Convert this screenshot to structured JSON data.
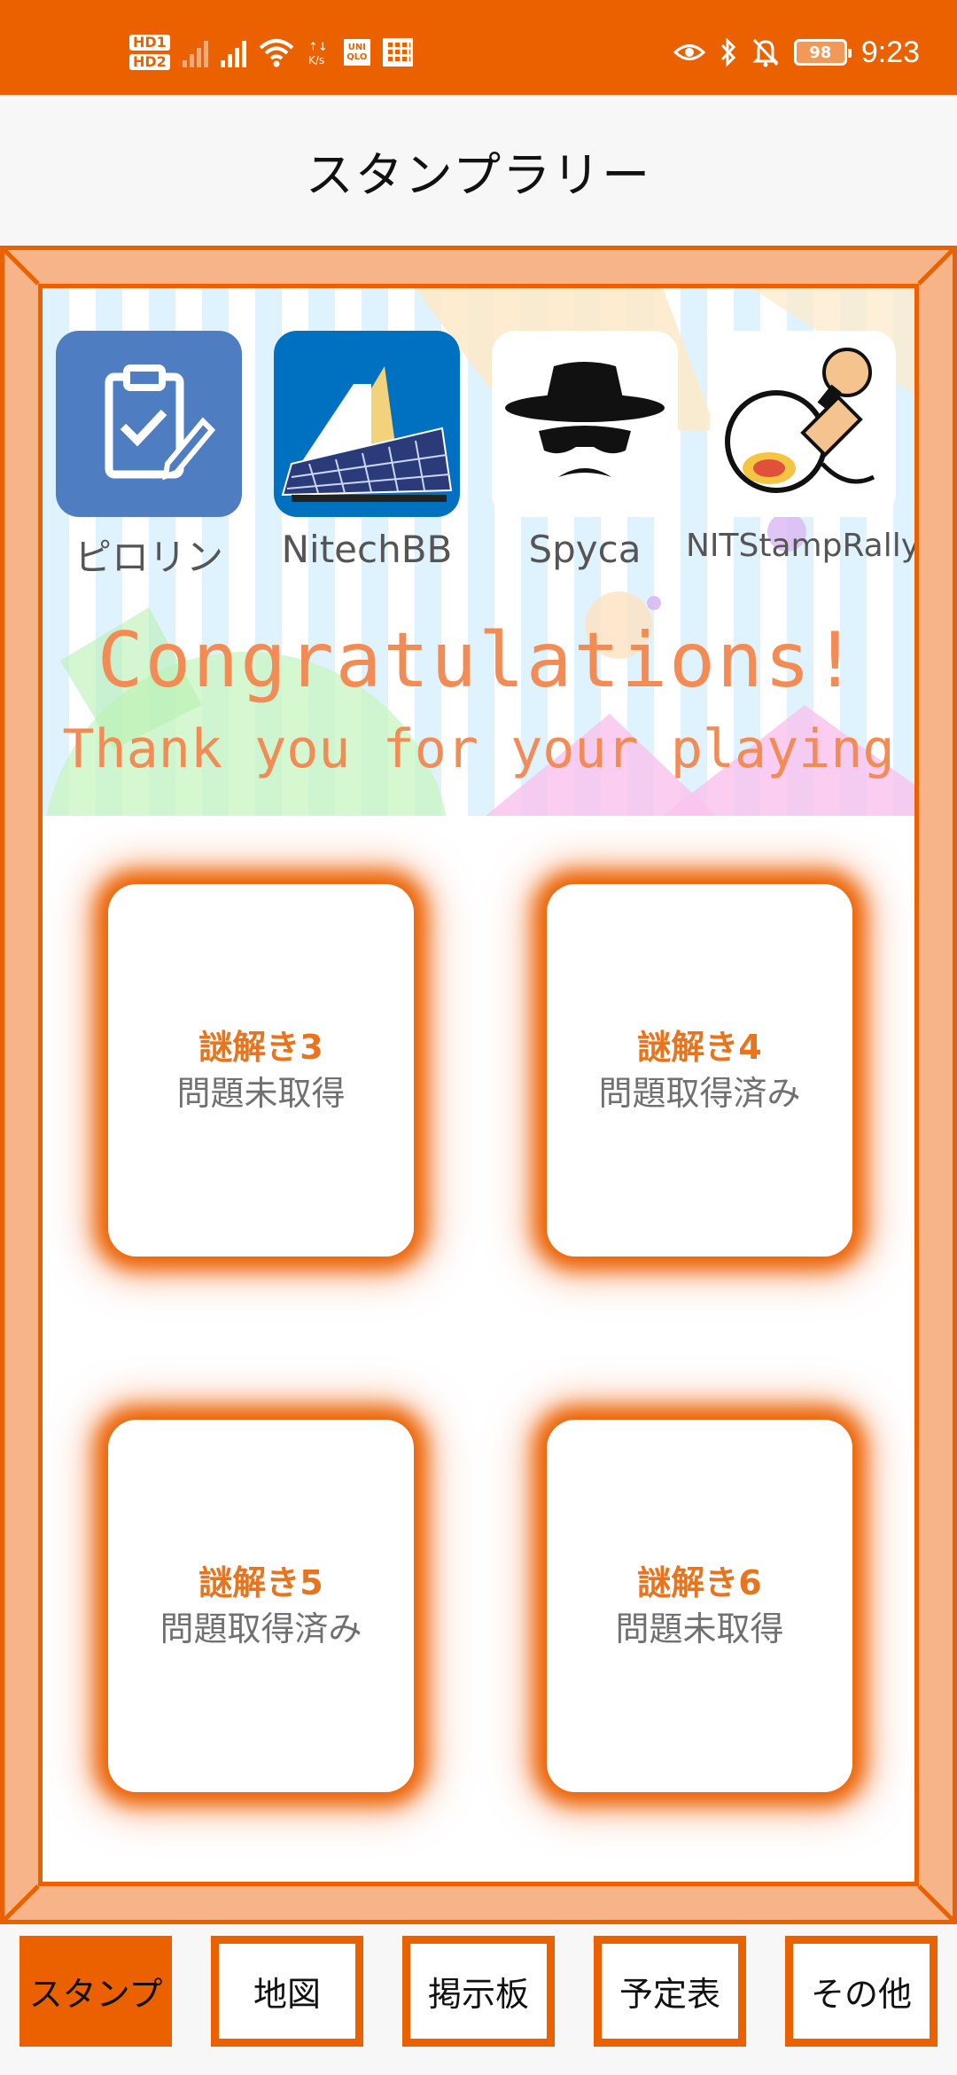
{
  "status_bar": {
    "hd_badges": [
      "HD1",
      "HD2"
    ],
    "icons": [
      "signal-weak-icon",
      "signal-icon",
      "wifi-icon",
      "data-speed-icon",
      "uniqlo-app-icon",
      "calendar-app-icon",
      "eye-icon",
      "bluetooth-icon",
      "bell-off-icon"
    ],
    "uniqlo_text": "UNI QLO",
    "battery": "98",
    "time": "9:23"
  },
  "header": {
    "title": "スタンプラリー"
  },
  "banner": {
    "apps": [
      {
        "label": "ピロリン",
        "icon": "clipboard-check-icon"
      },
      {
        "label": "NitechBB",
        "icon": "solar-building-icon"
      },
      {
        "label": "Spyca",
        "icon": "spy-icon"
      },
      {
        "label": "NITStampRally",
        "icon": "stamp-icon"
      }
    ],
    "line1": "Congratulations!",
    "line2": "Thank you for your playing"
  },
  "cards": [
    {
      "title": "謎解き3",
      "status": "問題未取得"
    },
    {
      "title": "謎解き4",
      "status": "問題取得済み"
    },
    {
      "title": "謎解き5",
      "status": "問題取得済み"
    },
    {
      "title": "謎解き6",
      "status": "問題未取得"
    }
  ],
  "nav": {
    "active": "スタンプ",
    "tabs": [
      "スタンプ",
      "地図",
      "掲示板",
      "予定表",
      "その他"
    ]
  },
  "colors": {
    "accent": "#EB6100",
    "frame_fill": "#F7B488",
    "card_title": "#E8741E",
    "card_status": "#707070",
    "banner_text": "#F38B55"
  }
}
